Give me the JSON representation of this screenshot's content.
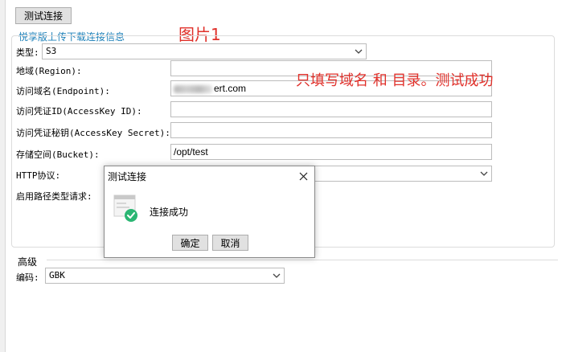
{
  "toolbar": {
    "test_button": "测试连接"
  },
  "link_text": "悦享版上传下载连接信息",
  "annotations": {
    "image_label": "图片1",
    "note": "只填写域名 和 目录。测试成功"
  },
  "form": {
    "type_label": "类型:",
    "type_value": "S3",
    "region_label": "地域(Region):",
    "region_value": "",
    "endpoint_label": "访问域名(Endpoint):",
    "endpoint_value": "ert.com",
    "access_key_label": "访问凭证ID(AccessKey ID):",
    "access_key_value": "",
    "secret_label": "访问凭证秘钥(AccessKey Secret):",
    "secret_value": "",
    "bucket_label": "存储空间(Bucket):",
    "bucket_value": "/opt/test",
    "http_label": "HTTP协议:",
    "http_value": "",
    "path_style_label": "启用路径类型请求:"
  },
  "advanced": {
    "section_label": "高级",
    "encoding_label": "编码:",
    "encoding_value": "GBK"
  },
  "dialog": {
    "title": "测试连接",
    "message": "连接成功",
    "ok": "确定",
    "cancel": "取消"
  },
  "colors": {
    "link": "#1a7fb8",
    "annotation": "#e0302a",
    "success": "#2bb673"
  }
}
